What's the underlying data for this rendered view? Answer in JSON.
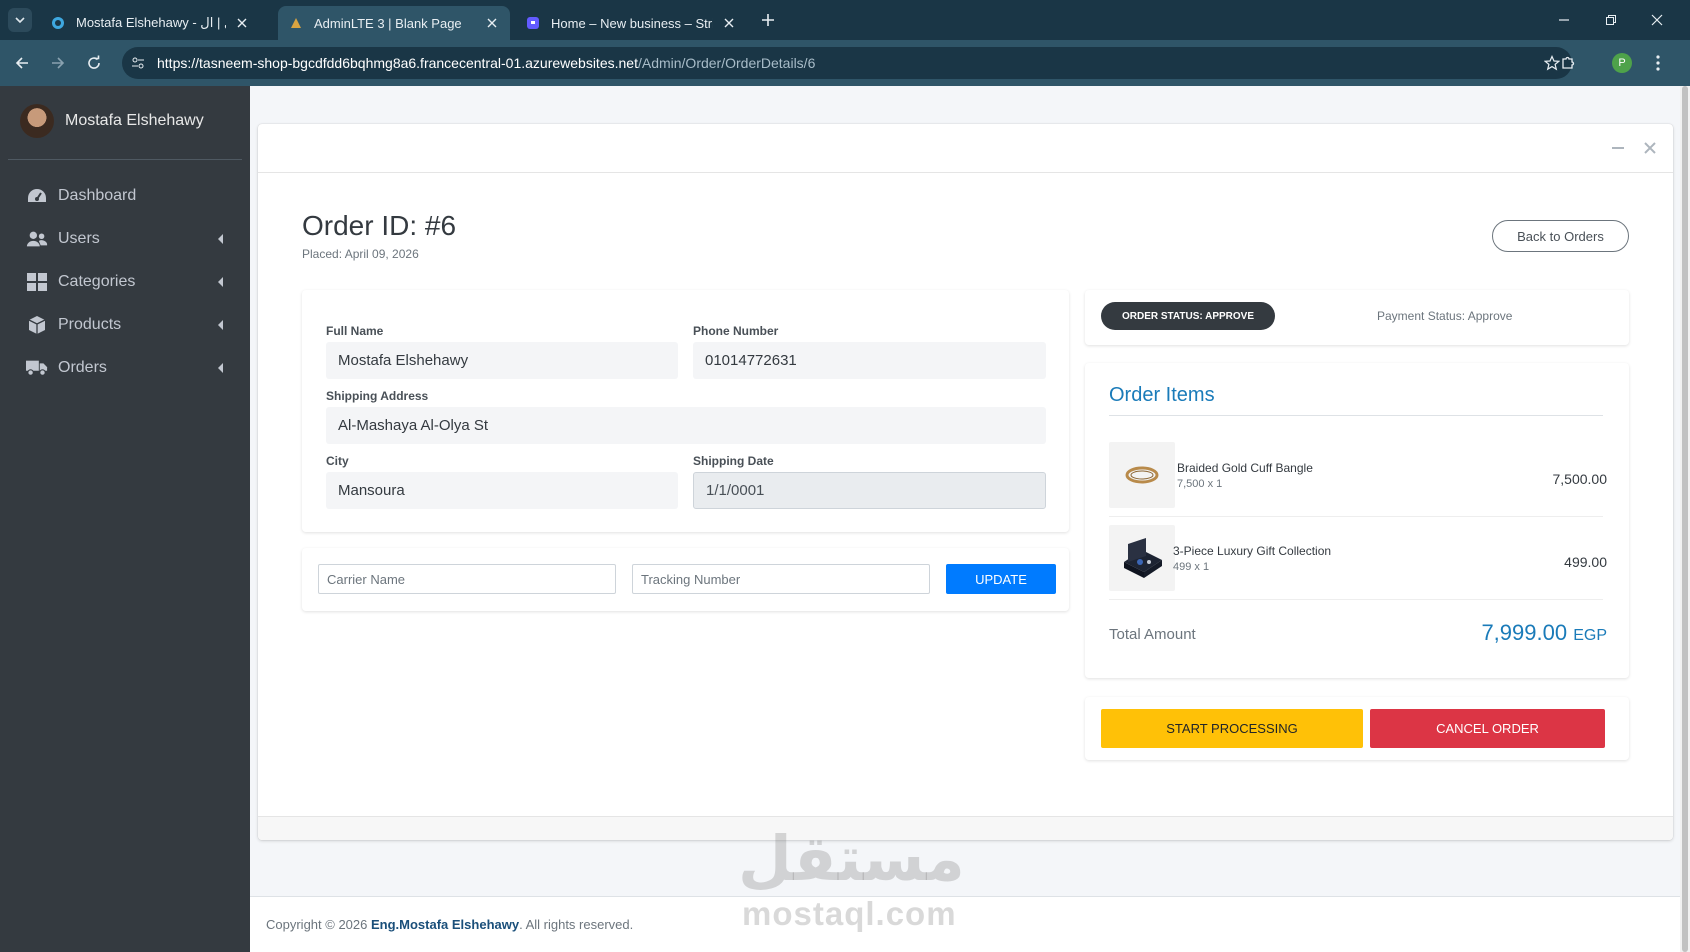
{
  "browser": {
    "tabs": [
      {
        "title": "Mostafa Elshehawy - مستقل | ال",
        "active": false
      },
      {
        "title": "AdminLTE 3 | Blank Page",
        "active": true
      },
      {
        "title": "Home – New business – Stripe [",
        "active": false
      }
    ],
    "url_host": "https://tasneem-shop-bgcdfdd6bqhmg8a6.francecentral-01.azurewebsites.net",
    "url_path": "/Admin/Order/OrderDetails/6",
    "profile_initial": "P"
  },
  "sidebar": {
    "user_name": "Mostafa Elshehawy",
    "items": [
      {
        "label": "Dashboard",
        "icon": "dashboard-icon",
        "has_children": false
      },
      {
        "label": "Users",
        "icon": "users-icon",
        "has_children": true
      },
      {
        "label": "Categories",
        "icon": "categories-icon",
        "has_children": true
      },
      {
        "label": "Products",
        "icon": "box-icon",
        "has_children": true
      },
      {
        "label": "Orders",
        "icon": "truck-icon",
        "has_children": true
      }
    ]
  },
  "order": {
    "title": "Order ID: #6",
    "placed": "Placed: April 09, 2026",
    "back_label": "Back to Orders",
    "fields": {
      "full_name_label": "Full Name",
      "full_name": "Mostafa Elshehawy",
      "phone_label": "Phone Number",
      "phone": "01014772631",
      "address_label": "Shipping Address",
      "address": "Al-Mashaya Al-Olya St",
      "city_label": "City",
      "city": "Mansoura",
      "shipping_date_label": "Shipping Date",
      "shipping_date": "1/1/0001"
    },
    "shipping_form": {
      "carrier_placeholder": "Carrier Name",
      "tracking_placeholder": "Tracking Number",
      "update_label": "UPDATE"
    },
    "status": {
      "order_status": "ORDER STATUS: APPROVE",
      "payment_status": "Payment Status: Approve"
    },
    "items_title": "Order Items",
    "items": [
      {
        "name": "Braided Gold Cuff Bangle",
        "qty": "7,500 x 1",
        "price": "7,500.00",
        "thumb": "bangle"
      },
      {
        "name": "3-Piece Luxury Gift Collection",
        "qty": "499 x 1",
        "price": "499.00",
        "thumb": "gift-box"
      }
    ],
    "total_label": "Total Amount",
    "total_value": "7,999.00",
    "total_currency": "EGP",
    "start_processing_label": "START PROCESSING",
    "cancel_label": "CANCEL ORDER"
  },
  "footer": {
    "prefix": "Copyright © 2026 ",
    "author": "Eng.Mostafa Elshehawy",
    "suffix": ". All rights reserved."
  },
  "watermark": {
    "arabic": "مستقل",
    "latin": "mostaql.com"
  },
  "colors": {
    "sidebar_bg": "#343a40",
    "primary": "#007bff",
    "warning": "#ffc107",
    "danger": "#dc3545",
    "accent_text": "#1a7bb9"
  }
}
